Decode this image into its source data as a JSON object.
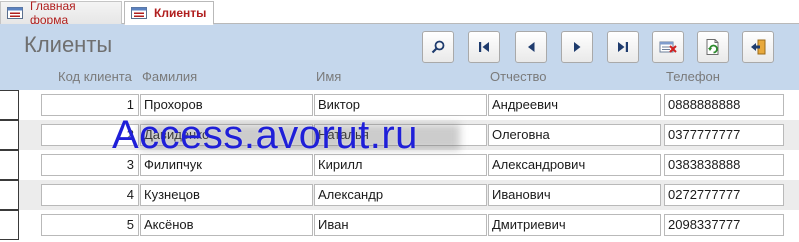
{
  "tabs": [
    {
      "label": "Главная форма",
      "active": false
    },
    {
      "label": "Клиенты",
      "active": true
    }
  ],
  "form": {
    "title": "Клиенты"
  },
  "toolbar": [
    {
      "name": "search-button",
      "icon": "magnifier-icon"
    },
    {
      "name": "first-record-button",
      "icon": "first-record-icon"
    },
    {
      "name": "previous-record-button",
      "icon": "previous-icon"
    },
    {
      "name": "next-record-button",
      "icon": "next-icon"
    },
    {
      "name": "last-record-button",
      "icon": "last-record-icon"
    },
    {
      "name": "delete-record-button",
      "icon": "delete-record-icon"
    },
    {
      "name": "refresh-button",
      "icon": "refresh-icon"
    },
    {
      "name": "close-form-button",
      "icon": "exit-icon"
    }
  ],
  "columns": [
    "Код клиента",
    "Фамилия",
    "Имя",
    "Отчество",
    "Телефон"
  ],
  "rows": [
    [
      "1",
      "Прохоров",
      "Виктор",
      "Андреевич",
      "0888888888"
    ],
    [
      "2",
      "Давиденко",
      "Наталья",
      "Олеговна",
      "0377777777"
    ],
    [
      "3",
      "Филипчук",
      "Кирилл",
      "Александрович",
      "0383838888"
    ],
    [
      "4",
      "Кузнецов",
      "Александр",
      "Иванович",
      "0272777777"
    ],
    [
      "5",
      "Аксёнов",
      "Иван",
      "Дмитриевич",
      "2098337777"
    ]
  ],
  "watermark": "Access.avorut.ru",
  "colors": {
    "header_bg": "#c5d7ec",
    "tab_text": "#b01e1e",
    "watermark": "#1f1fd8",
    "alt_row": "#ececec"
  }
}
